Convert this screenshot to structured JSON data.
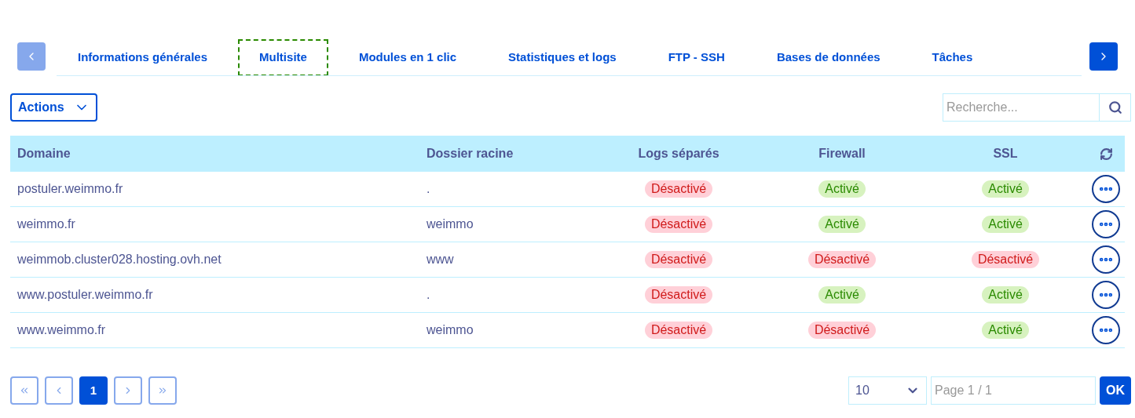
{
  "tabs": [
    {
      "label": "Informations générales",
      "selected": false
    },
    {
      "label": "Multisite",
      "selected": true
    },
    {
      "label": "Modules en 1 clic",
      "selected": false
    },
    {
      "label": "Statistiques et logs",
      "selected": false
    },
    {
      "label": "FTP - SSH",
      "selected": false
    },
    {
      "label": "Bases de données",
      "selected": false
    },
    {
      "label": "Tâches",
      "selected": false
    }
  ],
  "actions_button": "Actions",
  "search": {
    "placeholder": "Recherche..."
  },
  "table": {
    "columns": [
      "Domaine",
      "Dossier racine",
      "Logs séparés",
      "Firewall",
      "SSL"
    ],
    "rows": [
      {
        "domain": "postuler.weimmo.fr",
        "root": ".",
        "logs": {
          "active": false,
          "label": "Désactivé"
        },
        "firewall": {
          "active": true,
          "label": "Activé"
        },
        "ssl": {
          "active": true,
          "label": "Activé"
        }
      },
      {
        "domain": "weimmo.fr",
        "root": "weimmo",
        "logs": {
          "active": false,
          "label": "Désactivé"
        },
        "firewall": {
          "active": true,
          "label": "Activé"
        },
        "ssl": {
          "active": true,
          "label": "Activé"
        }
      },
      {
        "domain": "weimmob.cluster028.hosting.ovh.net",
        "root": "www",
        "logs": {
          "active": false,
          "label": "Désactivé"
        },
        "firewall": {
          "active": false,
          "label": "Désactivé"
        },
        "ssl": {
          "active": false,
          "label": "Désactivé"
        }
      },
      {
        "domain": "www.postuler.weimmo.fr",
        "root": ".",
        "logs": {
          "active": false,
          "label": "Désactivé"
        },
        "firewall": {
          "active": true,
          "label": "Activé"
        },
        "ssl": {
          "active": true,
          "label": "Activé"
        }
      },
      {
        "domain": "www.weimmo.fr",
        "root": "weimmo",
        "logs": {
          "active": false,
          "label": "Désactivé"
        },
        "firewall": {
          "active": false,
          "label": "Désactivé"
        },
        "ssl": {
          "active": true,
          "label": "Activé"
        }
      }
    ]
  },
  "pagination": {
    "pages": [
      {
        "label": "1",
        "selected": true
      }
    ],
    "page_size": "10",
    "page_field": {
      "placeholder": "Page 1 / 1"
    },
    "ok_button": "OK"
  }
}
